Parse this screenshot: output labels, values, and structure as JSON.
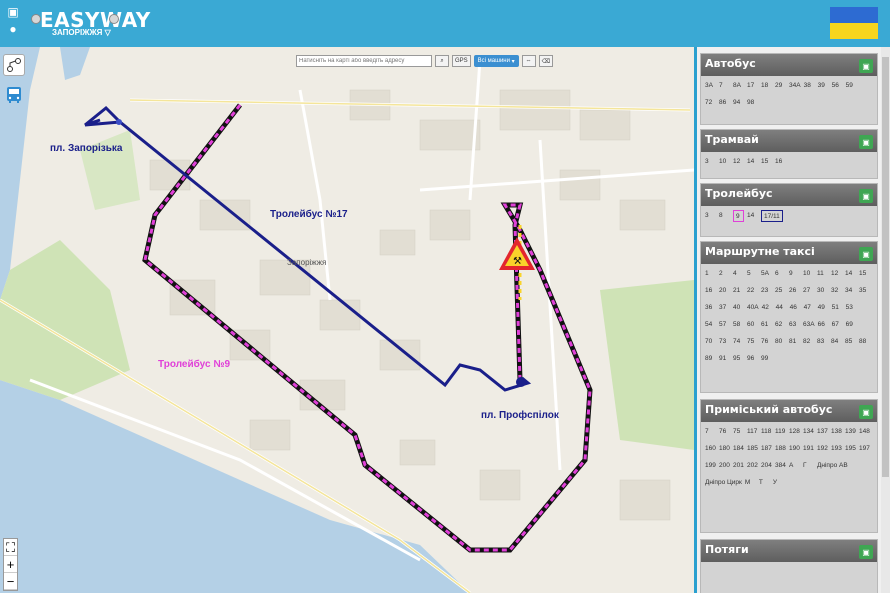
{
  "header": {
    "logo_text": "EASYWAY",
    "city": "ЗАПОРІЖЖЯ",
    "os_icons": [
      "android-icon",
      "apple-icon"
    ],
    "flag_colors": [
      "#2d6bd2",
      "#f7d51d"
    ]
  },
  "toolbar": {
    "search_placeholder": "Натисніть на карті або введіть адресу",
    "gps_label": "GPS",
    "vehicles_select": "Всі машини"
  },
  "map": {
    "labels": {
      "zaporizka": "пл. Запорізька",
      "trolley17": "Тролейбус №17",
      "trolley9": "Тролейбус №9",
      "profspilok": "пл. Профспілок",
      "city": "Запоріжжя"
    },
    "colors": {
      "route17": "#1a1f8a",
      "route9": "#e040d8",
      "work": "#f9d32a"
    }
  },
  "panel": {
    "sections": [
      {
        "title": "Автобус",
        "routes": [
          "3А",
          "7",
          "8А",
          "17",
          "18",
          "29",
          "34А",
          "38",
          "39",
          "56",
          "59",
          "72",
          "86",
          "94",
          "98"
        ]
      },
      {
        "title": "Трамвай",
        "routes": [
          "3",
          "10",
          "12",
          "14",
          "15",
          "16"
        ]
      },
      {
        "title": "Тролейбус",
        "routes": [
          "3",
          "8",
          "9",
          "14",
          "17/11"
        ]
      },
      {
        "title": "Маршрутне таксі",
        "routes": [
          "1",
          "2",
          "4",
          "5",
          "5А",
          "6",
          "9",
          "10",
          "11",
          "12",
          "14",
          "15",
          "16",
          "20",
          "21",
          "22",
          "23",
          "25",
          "26",
          "27",
          "30",
          "32",
          "34",
          "35",
          "36",
          "37",
          "40",
          "40А",
          "42",
          "44",
          "46",
          "47",
          "49",
          "51",
          "53",
          "54",
          "57",
          "58",
          "60",
          "61",
          "62",
          "63",
          "63А",
          "66",
          "67",
          "69",
          "70",
          "73",
          "74",
          "75",
          "76",
          "80",
          "81",
          "82",
          "83",
          "84",
          "85",
          "88",
          "89",
          "91",
          "95",
          "96",
          "99"
        ]
      },
      {
        "title": "Приміський автобус",
        "routes": [
          "7",
          "76",
          "75",
          "117",
          "118",
          "119",
          "128",
          "134",
          "137",
          "138",
          "139",
          "148",
          "160",
          "180",
          "184",
          "185",
          "187",
          "188",
          "190",
          "191",
          "192",
          "193",
          "195",
          "197",
          "199",
          "200",
          "201",
          "202",
          "204",
          "384",
          "А",
          "Г",
          "Дніпро АВ",
          "Дніпро Цирк",
          "М",
          "Т",
          "У"
        ]
      },
      {
        "title": "Потяги",
        "routes": []
      }
    ]
  }
}
